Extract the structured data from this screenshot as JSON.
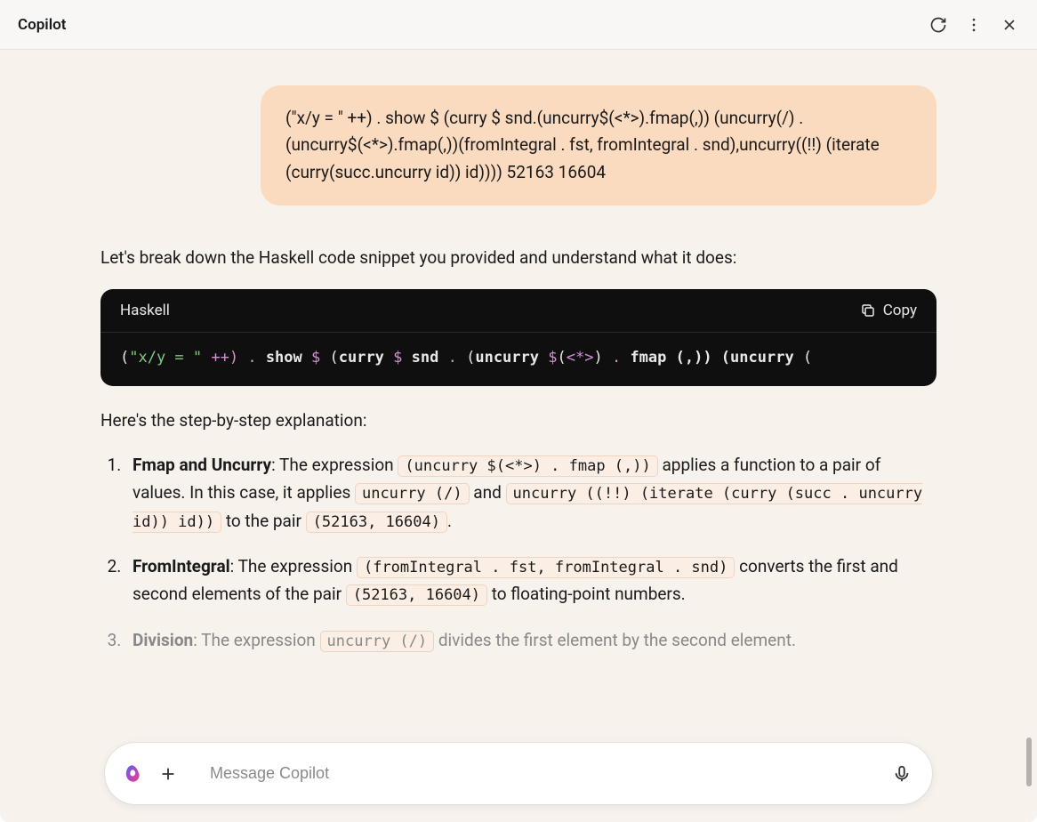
{
  "titlebar": {
    "title": "Copilot"
  },
  "user_message": "(\"x/y = \" ++) . show $ (curry $ snd.(uncurry$(<*>).fmap(,)) (uncurry(/) . (uncurry$(<*>).fmap(,))(fromIntegral . fst, fromIntegral . snd),uncurry((!!) (iterate (curry(succ.uncurry id)) id)))) 52163 16604",
  "assistant": {
    "intro": "Let's break down the Haskell code snippet you provided and understand what it does:",
    "code_lang": "Haskell",
    "code_copy": "Copy",
    "code_tokens": {
      "t0": "(",
      "t1": "\"x/y = \"",
      "t2": " ++) ",
      "t3": ".",
      "t4": " show ",
      "t5": "$",
      "t6": " (",
      "t7": "curry",
      "t8": " ",
      "t9": "$",
      "t10": " snd ",
      "t11": ".",
      "t12": " (",
      "t13": "uncurry",
      "t14": " ",
      "t15": "$",
      "t16": "(",
      "t17": "<*>",
      "t18": ") ",
      "t19": ".",
      "t20": " fmap (,)) (",
      "t21": "uncurry",
      "t22": " ("
    },
    "step_intro": "Here's the step-by-step explanation:",
    "steps": {
      "s1": {
        "title": "Fmap and Uncurry",
        "p1": ": The expression ",
        "c1": "(uncurry $(<*>) . fmap (,))",
        "p2": " applies a function to a pair of values. In this case, it applies ",
        "c2": "uncurry (/)",
        "p3": " and ",
        "c3": "uncurry ((!!) (iterate (curry (succ . uncurry id)) id))",
        "p4": " to the pair ",
        "c4": "(52163, 16604)",
        "p5": "."
      },
      "s2": {
        "title": "FromIntegral",
        "p1": ": The expression ",
        "c1": "(fromIntegral . fst, fromIntegral . snd)",
        "p2": " converts the first and second elements of the pair ",
        "c2": "(52163, 16604)",
        "p3": " to floating-point numbers."
      },
      "s3": {
        "title": "Division",
        "p1": ": The expression ",
        "c1": "uncurry (/)",
        "p2": " divides the first element by the second element."
      }
    }
  },
  "input": {
    "placeholder": "Message Copilot"
  }
}
